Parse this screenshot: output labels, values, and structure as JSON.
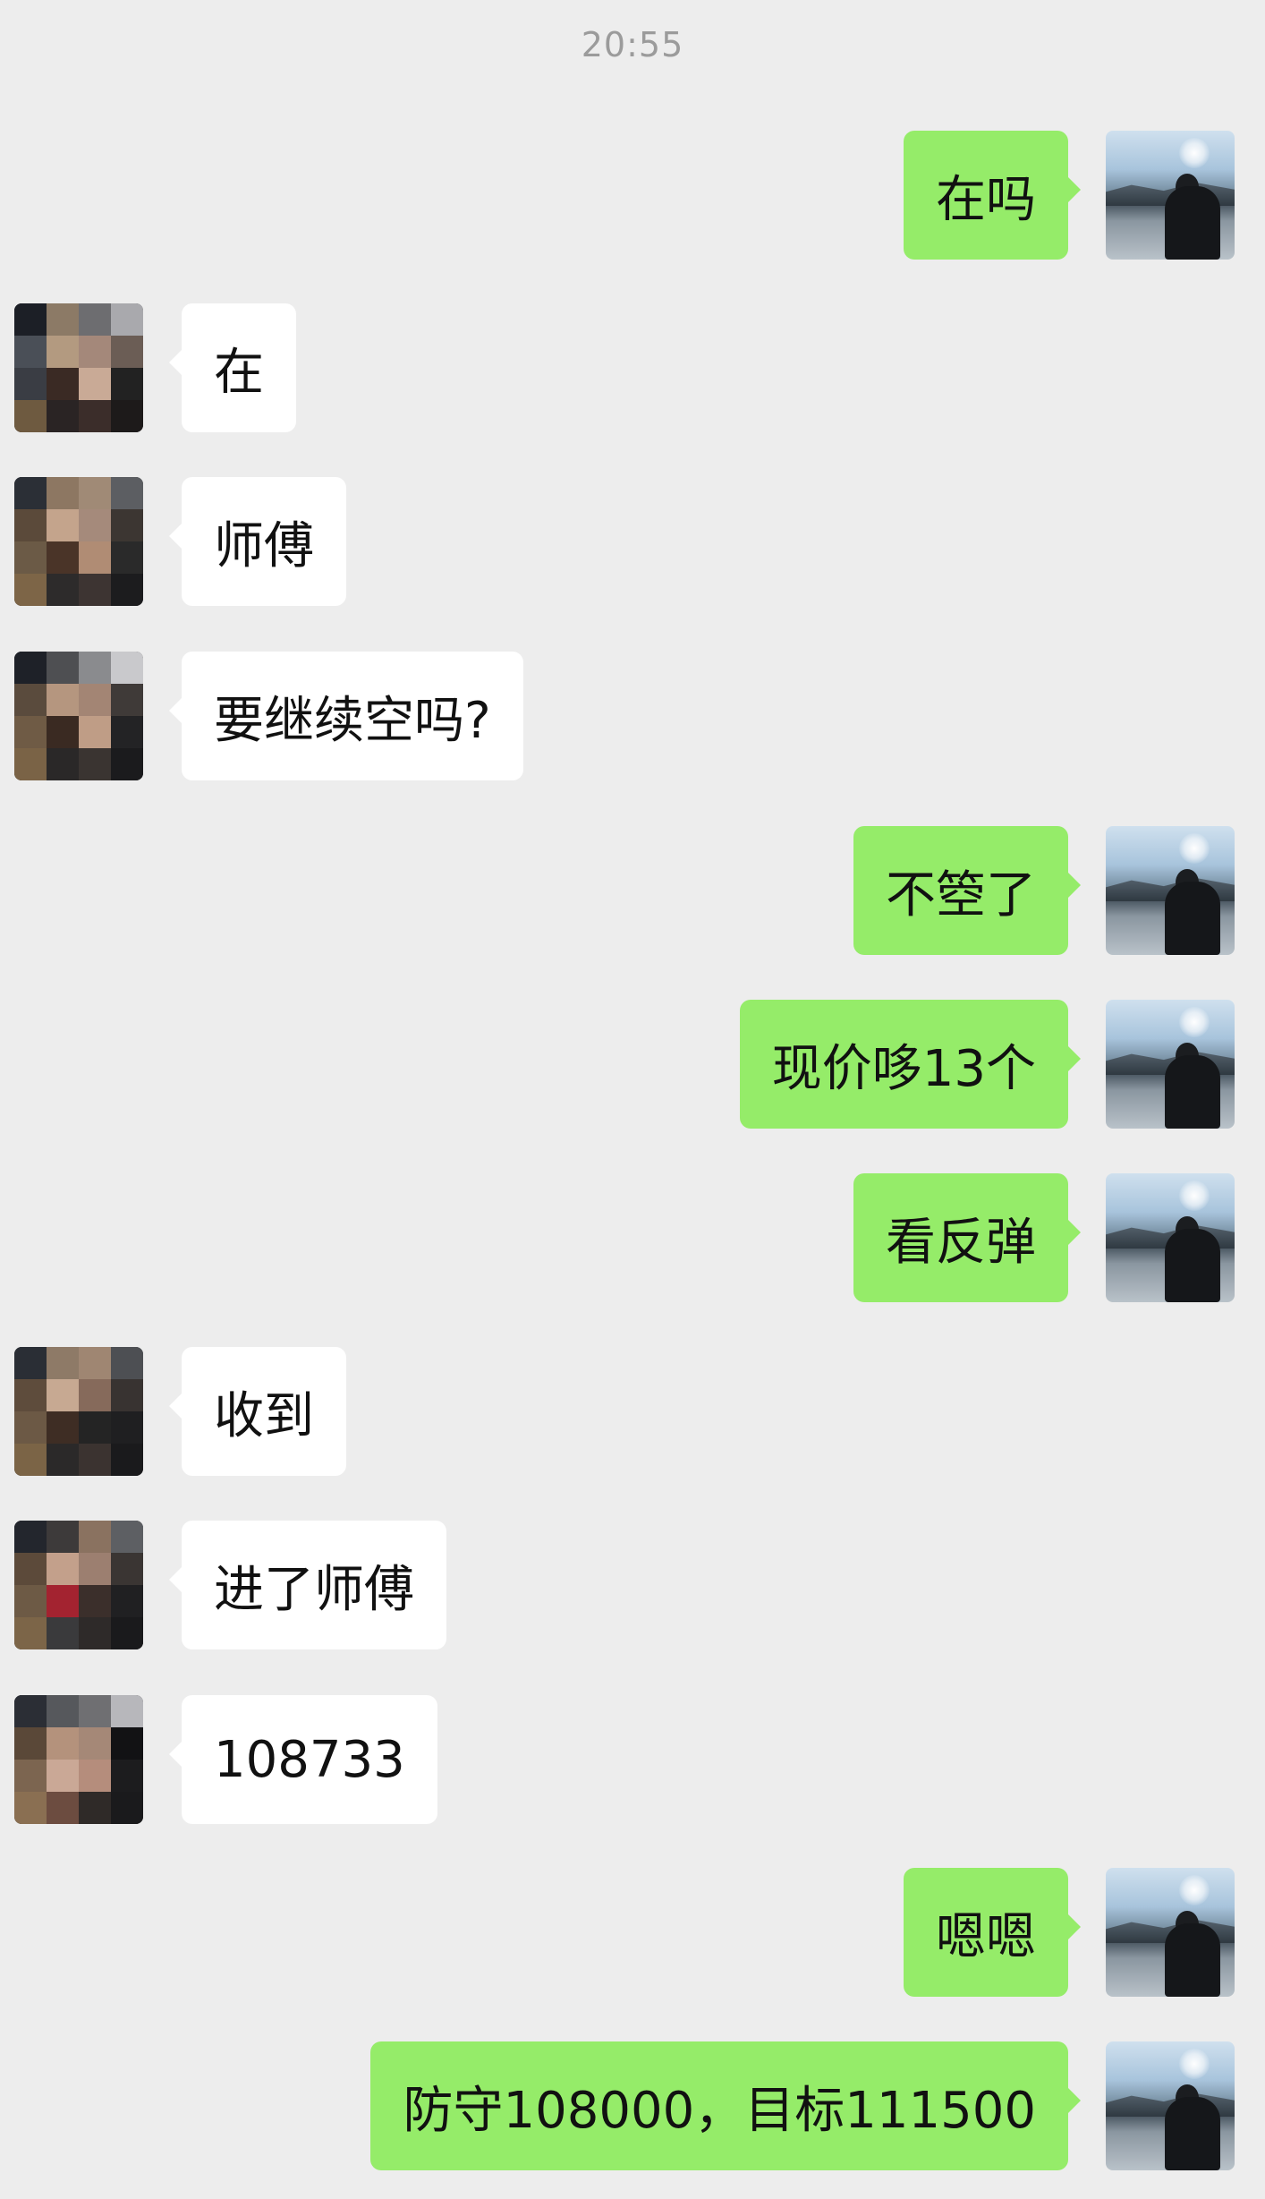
{
  "timestamp": "20:55",
  "messages": [
    {
      "side": "right",
      "text": "在吗"
    },
    {
      "side": "left",
      "text": "在"
    },
    {
      "side": "left",
      "text": "师傅"
    },
    {
      "side": "left",
      "text": "要继续空吗?"
    },
    {
      "side": "right",
      "text": "不箜了"
    },
    {
      "side": "right",
      "text": "现价哆13个"
    },
    {
      "side": "right",
      "text": "看反弹"
    },
    {
      "side": "left",
      "text": "收到"
    },
    {
      "side": "left",
      "text": "进了师傅"
    },
    {
      "side": "left",
      "text": "108733"
    },
    {
      "side": "right",
      "text": "嗯嗯"
    },
    {
      "side": "right",
      "text": "防守108000，目标111500"
    }
  ],
  "colors": {
    "background": "#ededed",
    "sent_bubble": "#95ec69",
    "received_bubble": "#ffffff",
    "timestamp_text": "#9b9b9b"
  },
  "icons": {
    "sender_avatar": "landscape-photo-avatar",
    "receiver_avatar": "pixelated-photo-avatar"
  }
}
